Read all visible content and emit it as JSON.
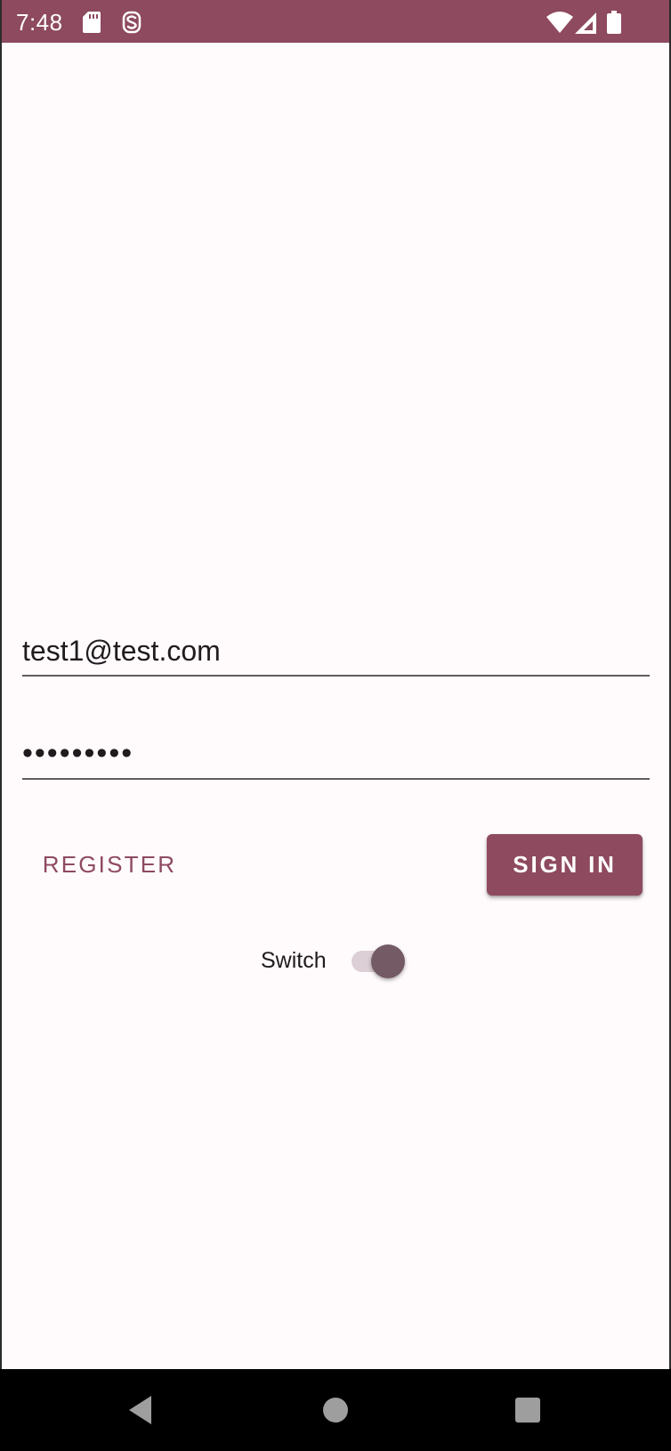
{
  "status_bar": {
    "time": "7:48",
    "background_color": "#8e4a5f",
    "icons": [
      "sd-card-icon",
      "sync-s-icon",
      "wifi-icon",
      "signal-icon",
      "battery-icon"
    ]
  },
  "login_form": {
    "email_value": "test1@test.com",
    "password_value": "•••••••••",
    "register_label": "REGISTER",
    "signin_label": "SIGN IN",
    "switch_label": "Switch",
    "switch_on": true,
    "accent_color": "#8e4a5f"
  },
  "nav_bar": {
    "buttons": [
      "back-icon",
      "home-icon",
      "recents-icon"
    ]
  }
}
